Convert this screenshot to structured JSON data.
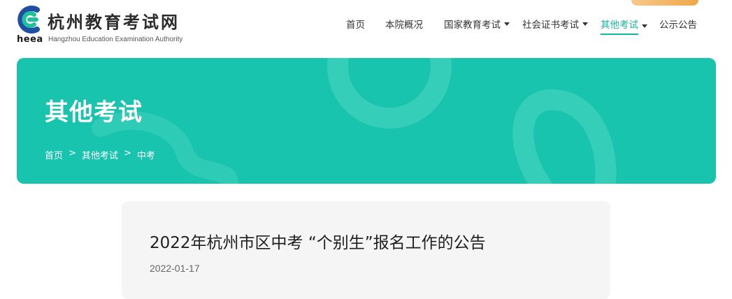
{
  "brand": {
    "name_cn": "杭州教育考试网",
    "name_en": "Hangzhou Education Examination Authority",
    "abbr": "heea",
    "logo_icon": "heea-logo-icon",
    "colors": {
      "primary": "#18c4ad",
      "accent": "#17b79c",
      "logo_blue": "#1e4fa3",
      "logo_green": "#20c09e"
    }
  },
  "nav": {
    "items": [
      {
        "label": "首页",
        "has_dropdown": false,
        "active": false
      },
      {
        "label": "本院概况",
        "has_dropdown": false,
        "active": false
      },
      {
        "label": "国家教育考试",
        "has_dropdown": true,
        "active": false
      },
      {
        "label": "社会证书考试",
        "has_dropdown": true,
        "active": false
      },
      {
        "label": "其他考试",
        "has_dropdown": true,
        "active": true
      },
      {
        "label": "公示公告",
        "has_dropdown": false,
        "active": false
      }
    ]
  },
  "banner": {
    "title": "其他考试",
    "breadcrumb": [
      "首页",
      "其他考试",
      "中考"
    ],
    "separator": ">"
  },
  "article": {
    "title": "2022年杭州市区中考 “个别生”报名工作的公告",
    "date": "2022-01-17"
  }
}
